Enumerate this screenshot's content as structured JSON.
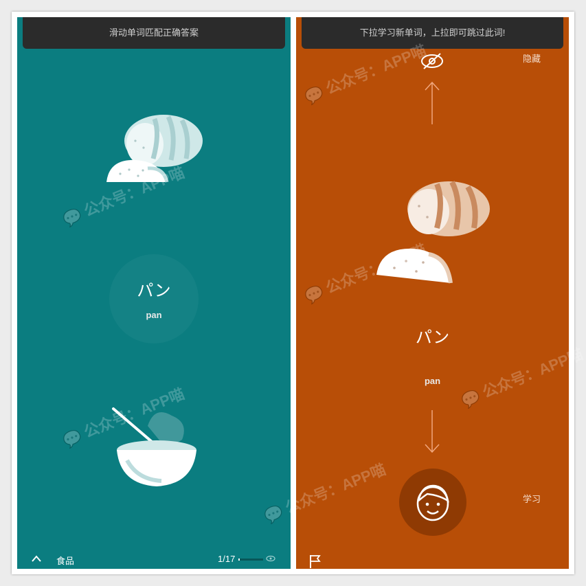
{
  "left": {
    "hint": "滑动单词匹配正确答案",
    "word_jp": "パン",
    "word_romaji": "pan",
    "category": "食品",
    "progress": "1/17",
    "progress_fraction": 0.06,
    "icons": [
      "bread-icon",
      "bowl-icon",
      "chevron-up-icon",
      "eye-icon"
    ]
  },
  "right": {
    "hint": "下拉学习新单词，上拉即可跳过此词!",
    "hide_label": "隐藏",
    "word_jp": "パン",
    "word_romaji": "pan",
    "learn_label": "学习",
    "icons": [
      "eye-slash-icon",
      "arrow-up-icon",
      "arrow-down-icon",
      "bread-icon",
      "face-icon",
      "flag-icon"
    ]
  },
  "watermark": "公众号：APP喵",
  "colors": {
    "left_bg": "#0b7d80",
    "right_bg": "#b84e07",
    "hint_bar": "#2b2b2b"
  }
}
